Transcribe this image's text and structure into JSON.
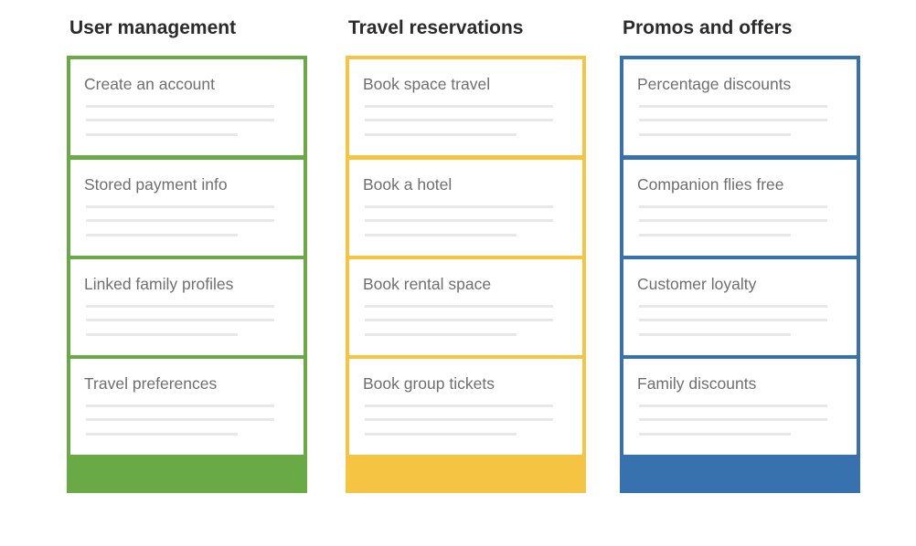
{
  "columns": [
    {
      "title": "User management",
      "color": "#6aaa46",
      "cards": [
        "Create an account",
        "Stored payment info",
        "Linked family profiles",
        "Travel preferences"
      ]
    },
    {
      "title": "Travel reservations",
      "color": "#f5c443",
      "cards": [
        "Book space travel",
        "Book a hotel",
        "Book rental space",
        "Book group tickets"
      ]
    },
    {
      "title": "Promos and offers",
      "color": "#3872ae",
      "cards": [
        "Percentage discounts",
        "Companion flies free",
        "Customer loyalty",
        "Family discounts"
      ]
    }
  ]
}
